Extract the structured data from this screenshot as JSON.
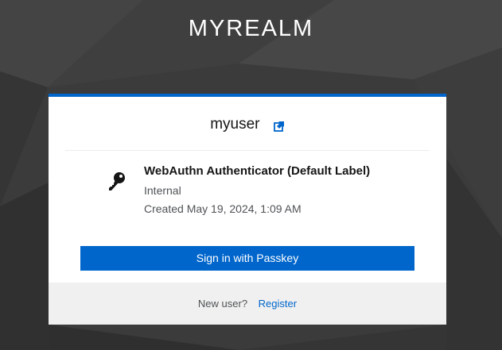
{
  "realm": {
    "title": "MYREALM"
  },
  "login": {
    "username": "myuser",
    "reset_icon": "external-link-icon"
  },
  "authenticator": {
    "icon": "key-icon",
    "label": "WebAuthn Authenticator (Default Label)",
    "transport": "Internal",
    "created": "Created May 19, 2024, 1:09 AM"
  },
  "actions": {
    "passkey_button": "Sign in with Passkey"
  },
  "footer": {
    "new_user_label": "New user?",
    "register_link": "Register"
  },
  "colors": {
    "primary": "#0066cc",
    "background": "#3a3a3a",
    "footer_bg": "#f0f0f0"
  }
}
